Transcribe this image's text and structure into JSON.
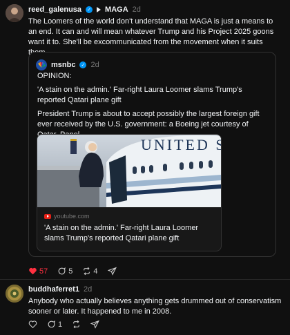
{
  "post1": {
    "username": "reed_galenusa",
    "topic": "MAGA",
    "time": "2d",
    "text": "The Loomers of the world don't understand that MAGA is just a means to an end. It can and will mean whatever Trump and his Project 2025 goons want it to. She'll be excommunicated from the movement when it suits them.",
    "quote": {
      "username": "msnbc",
      "time": "2d",
      "line1": "OPINION:",
      "line2": "'A stain on the admin.' Far-right Laura Loomer slams Trump's reported Qatari plane gift",
      "line3": "President Trump is about to accept possibly the largest foreign gift ever received by the U.S. government: a Boeing jet courtesy of Qatar. Panel...",
      "link": {
        "source": "youtube.com",
        "title": "'A stain on the admin.' Far-right Laura Loomer slams Trump's reported Qatari plane gift"
      }
    },
    "actions": {
      "likes": "57",
      "replies": "5",
      "reposts": "4"
    }
  },
  "post2": {
    "username": "buddhaferret1",
    "time": "2d",
    "text": "Anybody who actually believes anything gets drummed out of conservatism sooner or later. It happened to me in 2008.",
    "actions": {
      "replies": "1"
    }
  },
  "colors": {
    "like": "#ff3040",
    "verified": "#0095f6",
    "background": "#101010"
  }
}
